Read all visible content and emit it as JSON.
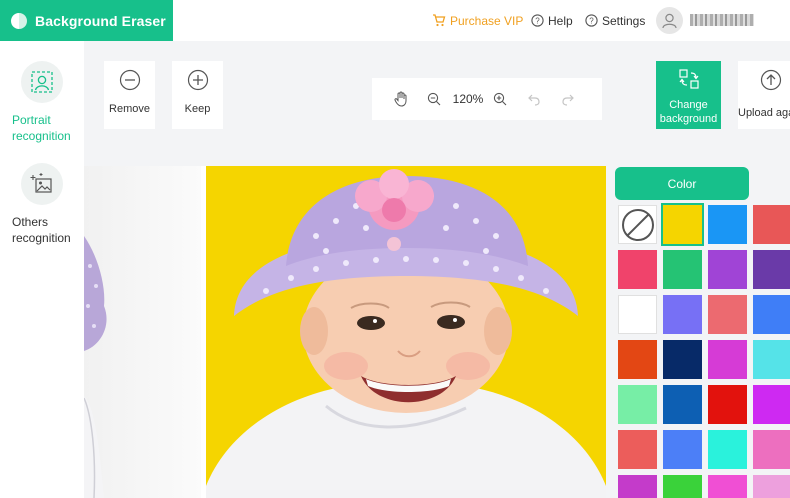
{
  "app": {
    "title": "Background Eraser",
    "brand_color": "#17c08b"
  },
  "topbar": {
    "purchase_label": "Purchase VIP",
    "help_label": "Help",
    "settings_label": "Settings"
  },
  "sidebar": {
    "items": [
      {
        "label_line1": "Portrait",
        "label_line2": "recognition",
        "icon": "portrait-frame-icon",
        "active": true
      },
      {
        "label_line1": "Others",
        "label_line2": "recognition",
        "icon": "image-sparkle-icon",
        "active": false
      }
    ]
  },
  "toolbar": {
    "remove_label": "Remove",
    "keep_label": "Keep",
    "zoom_level": "120%",
    "change_bg_line1": "Change",
    "change_bg_line2": "background",
    "upload_label": "Upload again"
  },
  "color_panel": {
    "tab_label": "Color",
    "swatches": [
      "none",
      "#f5d500",
      "#1a96f5",
      "#e85757",
      "#f0436b",
      "#25c374",
      "#a044d6",
      "#6a3aa8",
      "#ffffff",
      "#7770f5",
      "#ec6a70",
      "#3f7ef7",
      "#e34714",
      "#072a68",
      "#d63bd6",
      "#55e3e8",
      "#77eea6",
      "#0d5fb3",
      "#e2120d",
      "#ce29f2",
      "#ec5d5b",
      "#4c7ff7",
      "#2af2dc",
      "#ed6fbf",
      "#c43bca",
      "#3ad23a",
      "#f04fd4",
      "#eda0dd"
    ],
    "selected_index": 1
  }
}
